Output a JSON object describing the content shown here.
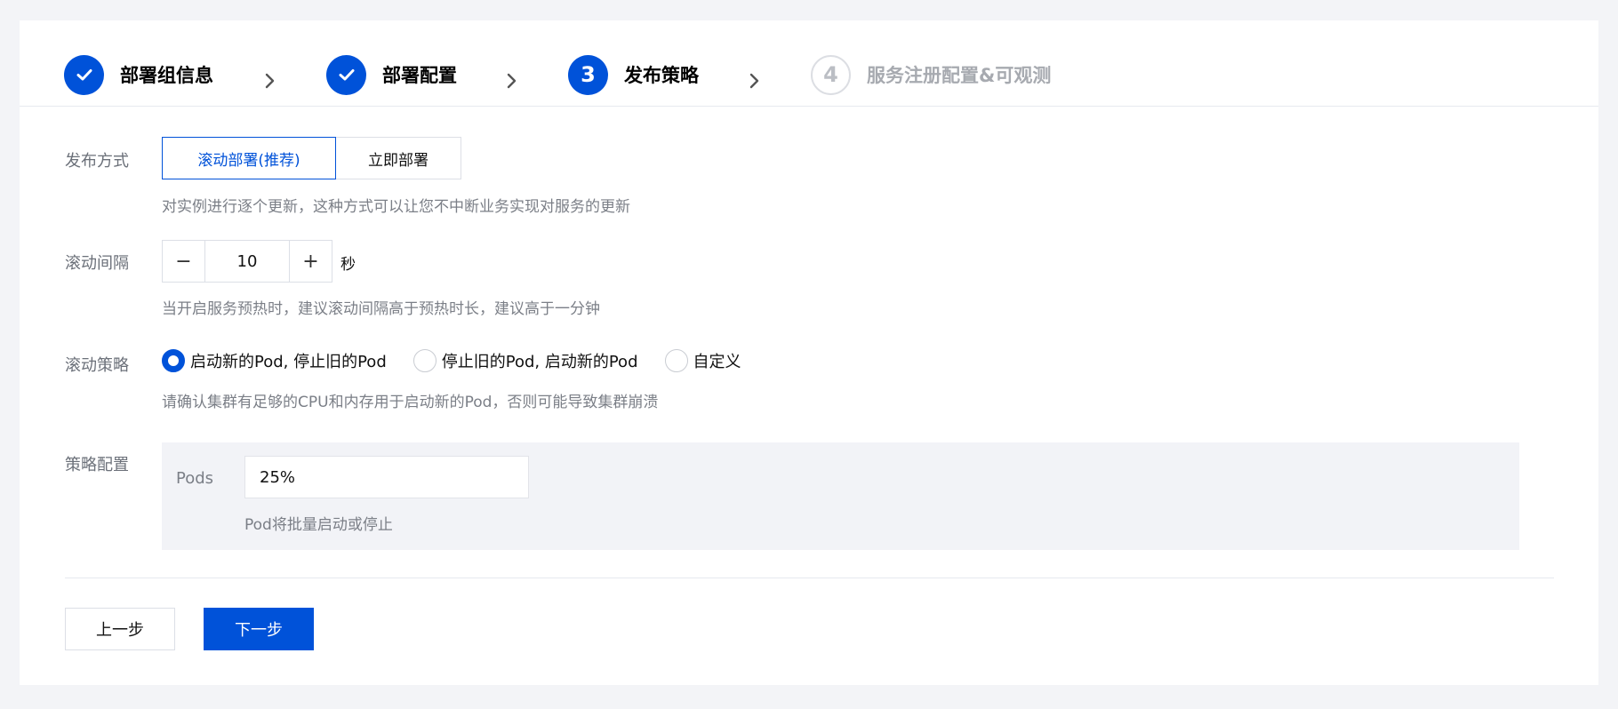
{
  "steps": [
    {
      "label": "部署组信息",
      "state": "done"
    },
    {
      "label": "部署配置",
      "state": "done"
    },
    {
      "label": "发布策略",
      "state": "active",
      "number": "3"
    },
    {
      "label": "服务注册配置&可观测",
      "state": "pending",
      "number": "4"
    }
  ],
  "deploy_mode": {
    "label": "发布方式",
    "options": [
      "滚动部署(推荐)",
      "立即部署"
    ],
    "selected": "滚动部署(推荐)",
    "help": "对实例进行逐个更新，这种方式可以让您不中断业务实现对服务的更新"
  },
  "interval": {
    "label": "滚动间隔",
    "value": "10",
    "unit": "秒",
    "minus": "−",
    "plus": "+",
    "help": "当开启服务预热时，建议滚动间隔高于预热时长，建议高于一分钟"
  },
  "strategy": {
    "label": "滚动策略",
    "options": [
      "启动新的Pod, 停止旧的Pod",
      "停止旧的Pod, 启动新的Pod",
      "自定义"
    ],
    "selected": "启动新的Pod, 停止旧的Pod",
    "help": "请确认集群有足够的CPU和内存用于启动新的Pod，否则可能导致集群崩溃"
  },
  "config": {
    "label": "策略配置",
    "pods_label": "Pods",
    "pods_value": "25%",
    "pods_help": "Pod将批量启动或停止"
  },
  "footer": {
    "prev": "上一步",
    "next": "下一步"
  },
  "colors": {
    "accent": "#0052d9",
    "background": "#f3f4f7"
  }
}
